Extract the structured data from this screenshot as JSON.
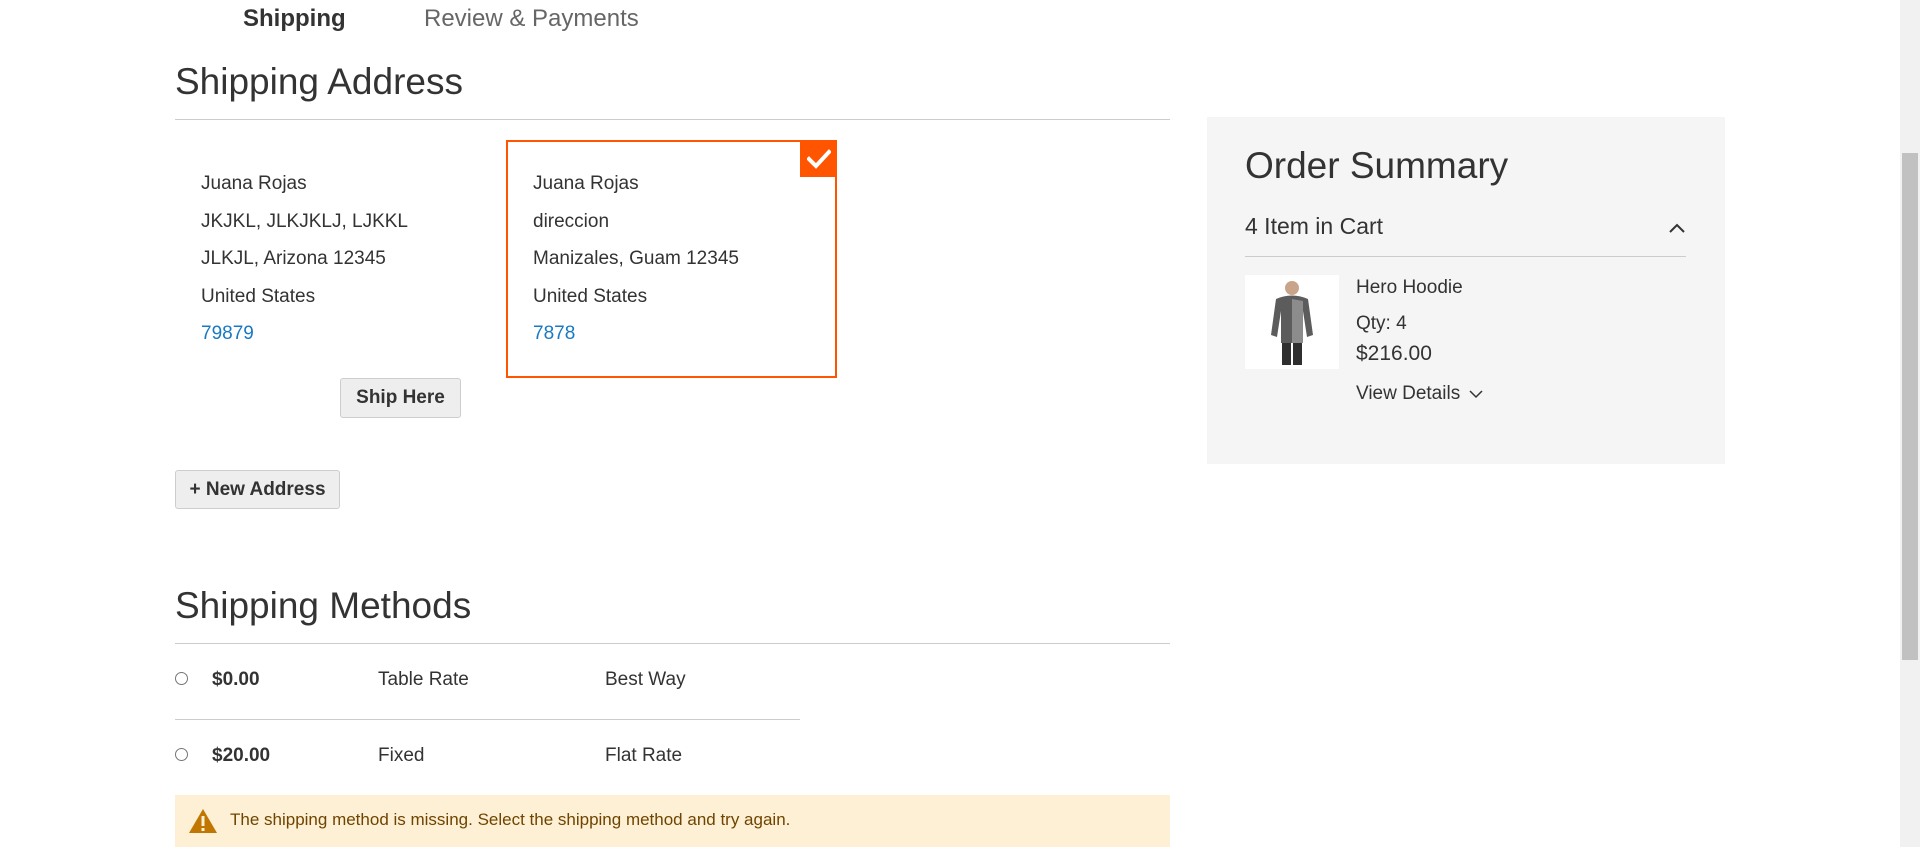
{
  "progress": {
    "steps": [
      {
        "label": "Shipping",
        "active": true
      },
      {
        "label": "Review & Payments",
        "active": false
      }
    ]
  },
  "shipping_address": {
    "title": "Shipping Address",
    "addresses": [
      {
        "name": "Juana Rojas",
        "street": "JKJKL, JLKJKLJ, LJKKL",
        "city_region": "JLKJL, Arizona 12345",
        "country": "United States",
        "phone": "79879",
        "selected": false,
        "action_label": "Ship Here"
      },
      {
        "name": "Juana Rojas",
        "street": "direccion",
        "city_region": "Manizales, Guam 12345",
        "country": "United States",
        "phone": "7878",
        "selected": true
      }
    ],
    "new_address_label": "+ New Address"
  },
  "shipping_methods": {
    "title": "Shipping Methods",
    "methods": [
      {
        "price": "$0.00",
        "method_title": "Table Rate",
        "carrier": "Best Way"
      },
      {
        "price": "$20.00",
        "method_title": "Fixed",
        "carrier": "Flat Rate"
      }
    ],
    "error": "The shipping method is missing. Select the shipping method and try again."
  },
  "order_summary": {
    "title": "Order Summary",
    "items_count": "4 Item in Cart",
    "item": {
      "name": "Hero Hoodie",
      "qty": "Qty: 4",
      "price": "$216.00",
      "view_details": "View Details"
    }
  },
  "colors": {
    "accent": "#ff5501",
    "link": "#1979c3",
    "summary_bg": "#f5f5f5",
    "warning_bg": "#fdf0d5",
    "warning_icon": "#c07600"
  },
  "icons": [
    "checkmark-icon",
    "chevron-up-icon",
    "chevron-down-icon",
    "warning-icon"
  ]
}
